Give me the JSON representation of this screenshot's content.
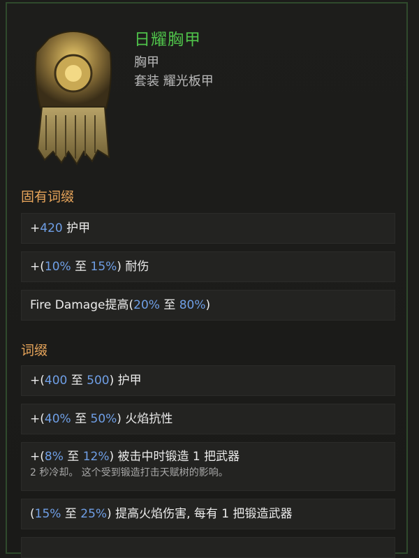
{
  "item": {
    "name": "日耀胸甲",
    "type": "胸甲",
    "set": "套装 耀光板甲"
  },
  "implicit": {
    "title": "固有词缀",
    "affixes": [
      {
        "prefix": "+",
        "n1": "420",
        "mid": "",
        "n2": "",
        "suffix": " 护甲"
      },
      {
        "prefix": "+(",
        "n1": "10%",
        "mid": " 至 ",
        "n2": "15%",
        "suffix": ") 耐伤"
      },
      {
        "prefix": "Fire Damage提高(",
        "n1": "20%",
        "mid": " 至 ",
        "n2": "80%",
        "suffix": ")"
      }
    ]
  },
  "explicit": {
    "title": "词缀",
    "affixes": [
      {
        "prefix": "+(",
        "n1": "400",
        "mid": " 至 ",
        "n2": "500",
        "suffix": ") 护甲"
      },
      {
        "prefix": "+(",
        "n1": "40%",
        "mid": " 至 ",
        "n2": "50%",
        "suffix": ") 火焰抗性"
      },
      {
        "prefix": "+(",
        "n1": "8%",
        "mid": " 至 ",
        "n2": "12%",
        "suffix": ") 被击中时锻造 1 把武器",
        "note": "2 秒冷却。 这个受到锻造打击天赋树的影响。"
      },
      {
        "prefix": "(",
        "n1": "15%",
        "mid": " 至 ",
        "n2": "25%",
        "suffix": ") 提高火焰伤害, 每有 1 把锻造武器"
      }
    ]
  },
  "colors": {
    "name": "#4fc24a",
    "section": "#e6a45a",
    "number": "#6f9fe6"
  },
  "icons": {
    "item_art": "gold-plate-chest-armor-icon"
  }
}
